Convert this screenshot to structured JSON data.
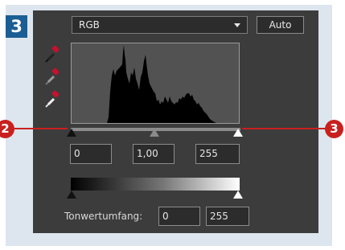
{
  "step_number": "3",
  "levels": {
    "channel": "RGB",
    "auto_label": "Auto",
    "input_black": "0",
    "input_gamma": "1,00",
    "input_white": "255",
    "output_label": "Tonwertumfang:",
    "output_black": "0",
    "output_white": "255"
  },
  "callouts": {
    "left": "2",
    "right": "3"
  },
  "colors": {
    "step_badge": "#1b5e93",
    "callout": "#c8201f",
    "dropper_tip": "#c8102e",
    "panel": "#3c3c3c"
  },
  "icons": [
    "black-point-eyedropper-icon",
    "gray-point-eyedropper-icon",
    "white-point-eyedropper-icon"
  ]
}
